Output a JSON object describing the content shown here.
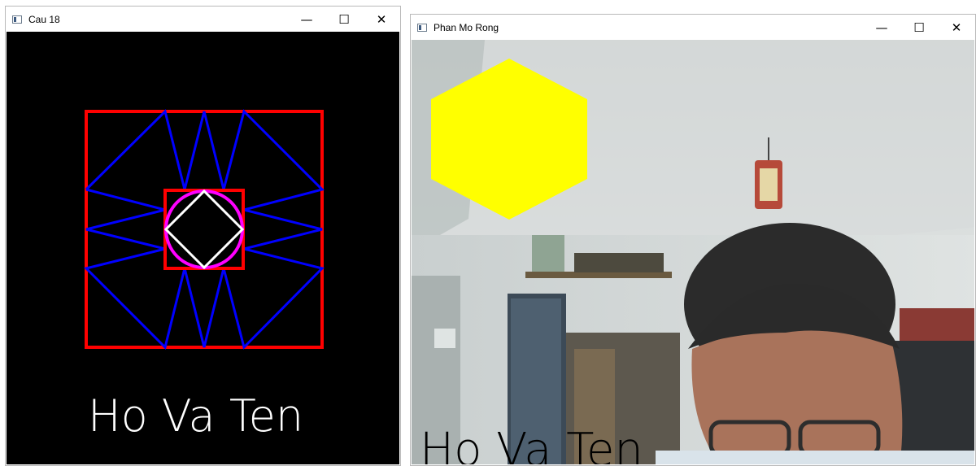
{
  "window_left": {
    "title": "Cau 18",
    "caption": "Ho Va Ten",
    "controls": {
      "minimize": "—",
      "maximize": "☐",
      "close": "✕"
    }
  },
  "window_right": {
    "title": "Phan Mo Rong",
    "caption": "Ho Va Ten",
    "controls": {
      "minimize": "—",
      "maximize": "☐",
      "close": "✕"
    }
  },
  "colors": {
    "red": "#ff0000",
    "blue": "#0000ff",
    "magenta": "#ff00ff",
    "white": "#ffffff",
    "yellow": "#ffff00",
    "canvas": "#000000"
  }
}
